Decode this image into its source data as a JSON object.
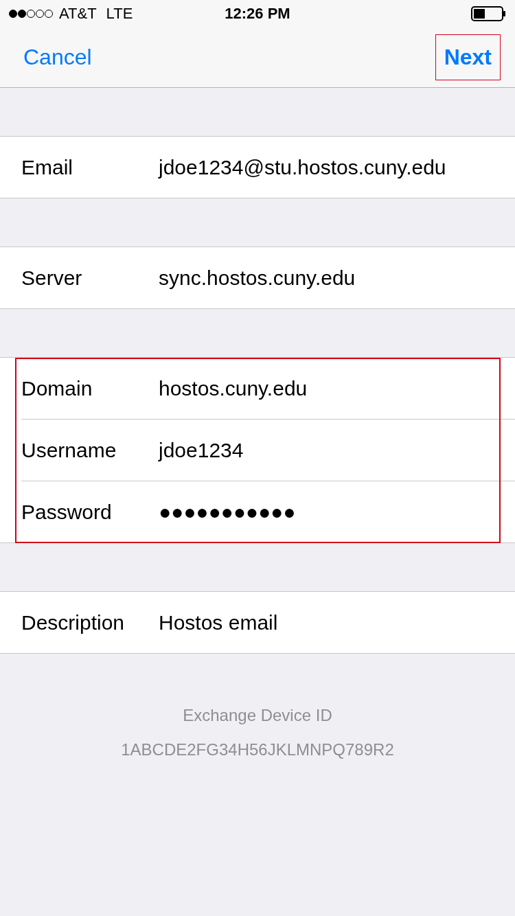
{
  "status_bar": {
    "carrier": "AT&T",
    "network": "LTE",
    "time": "12:26 PM"
  },
  "nav": {
    "cancel": "Cancel",
    "next": {
      "label": "Next",
      "highlighted": true
    }
  },
  "sections": [
    {
      "highlighted": false,
      "rows": [
        {
          "label": "Email",
          "value": "jdoe1234@stu.hostos.cuny.edu"
        }
      ]
    },
    {
      "highlighted": false,
      "rows": [
        {
          "label": "Server",
          "value": "sync.hostos.cuny.edu"
        }
      ]
    },
    {
      "highlighted": true,
      "rows": [
        {
          "label": "Domain",
          "value": "hostos.cuny.edu"
        },
        {
          "label": "Username",
          "value": "jdoe1234"
        },
        {
          "label": "Password",
          "value": "●●●●●●●●●●●"
        }
      ]
    },
    {
      "highlighted": false,
      "rows": [
        {
          "label": "Description",
          "value": "Hostos email"
        }
      ]
    }
  ],
  "footer": {
    "title": "Exchange Device ID",
    "device_id": "1ABCDE2FG34H56JKLMNPQ789R2"
  }
}
